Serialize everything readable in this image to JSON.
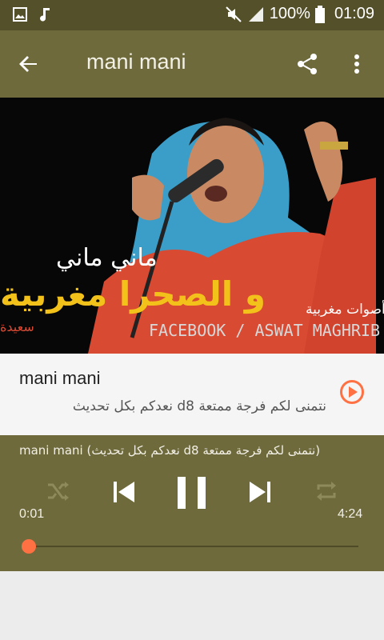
{
  "status": {
    "battery": "100%",
    "time": "01:09"
  },
  "toolbar": {
    "title": "mani mani"
  },
  "hero": {
    "overlay_arabic_top": "ماني ماني",
    "overlay_arabic_main": "و الصحرا مغربية",
    "overlay_arabic_small": "سعيدة",
    "overlay_arabic_right": "أصوات مغربية",
    "overlay_text": "FACEBOOK / ASWAT MAGHRIB"
  },
  "track": {
    "title": "mani mani",
    "subtitle": "نتمنى لكم فرجة ممتعة d8 نعدكم بكل تحديث"
  },
  "player": {
    "now_playing": "mani mani (نعدكم بكل تحديث d8 نتمنى لكم فرجة ممتعة)",
    "current_time": "0:01",
    "duration": "4:24",
    "progress": 0.004
  },
  "colors": {
    "toolbar": "#6e6a3c",
    "statusbar": "#54502a",
    "accent": "#ff7043"
  },
  "icons": [
    "gallery-icon",
    "music-note-icon",
    "mute-icon",
    "signal-icon",
    "battery-icon",
    "back-arrow-icon",
    "share-icon",
    "more-vert-icon",
    "play-circle-icon",
    "shuffle-icon",
    "previous-icon",
    "pause-icon",
    "next-icon",
    "repeat-icon"
  ]
}
